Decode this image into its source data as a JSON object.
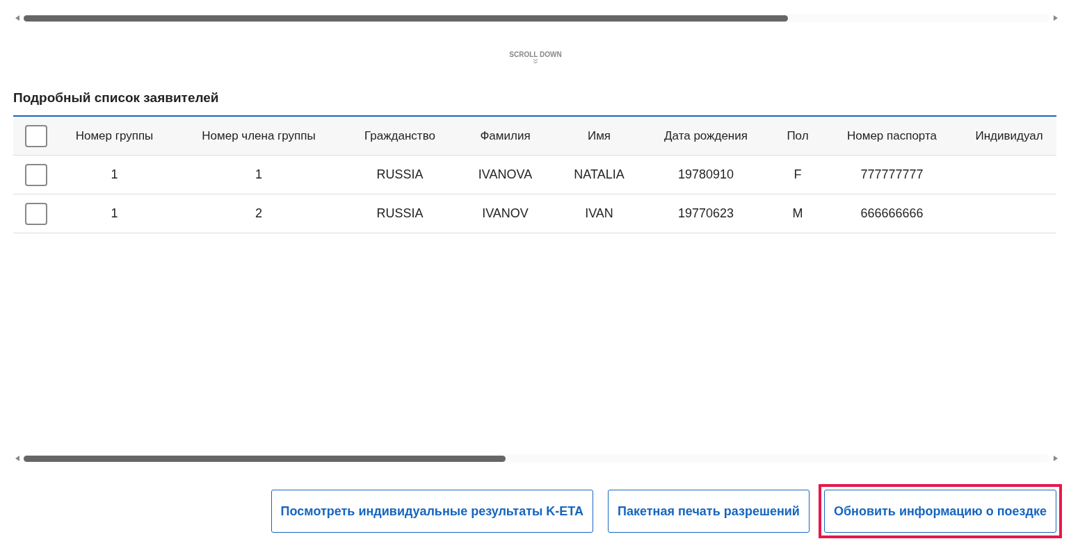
{
  "scroll_hint": {
    "label": "SCROLL DOWN"
  },
  "section_title": "Подробный список заявителей",
  "table": {
    "select_all": {
      "checked": false
    },
    "columns": [
      "Номер группы",
      "Номер члена группы",
      "Гражданство",
      "Фамилия",
      "Имя",
      "Дата рождения",
      "Пол",
      "Номер паспорта",
      "Индивидуал"
    ],
    "rows": [
      {
        "checked": false,
        "cells": [
          "1",
          "1",
          "RUSSIA",
          "IVANOVA",
          "NATALIA",
          "19780910",
          "F",
          "777777777",
          ""
        ]
      },
      {
        "checked": false,
        "cells": [
          "1",
          "2",
          "RUSSIA",
          "IVANOV",
          "IVAN",
          "19770623",
          "M",
          "666666666",
          ""
        ]
      }
    ]
  },
  "buttons": [
    {
      "label": "Посмотреть индивидуальные результаты K-ETA",
      "highlighted": false
    },
    {
      "label": "Пакетная печать разрешений",
      "highlighted": false
    },
    {
      "label": "Обновить информацию о поездке",
      "highlighted": true
    }
  ]
}
